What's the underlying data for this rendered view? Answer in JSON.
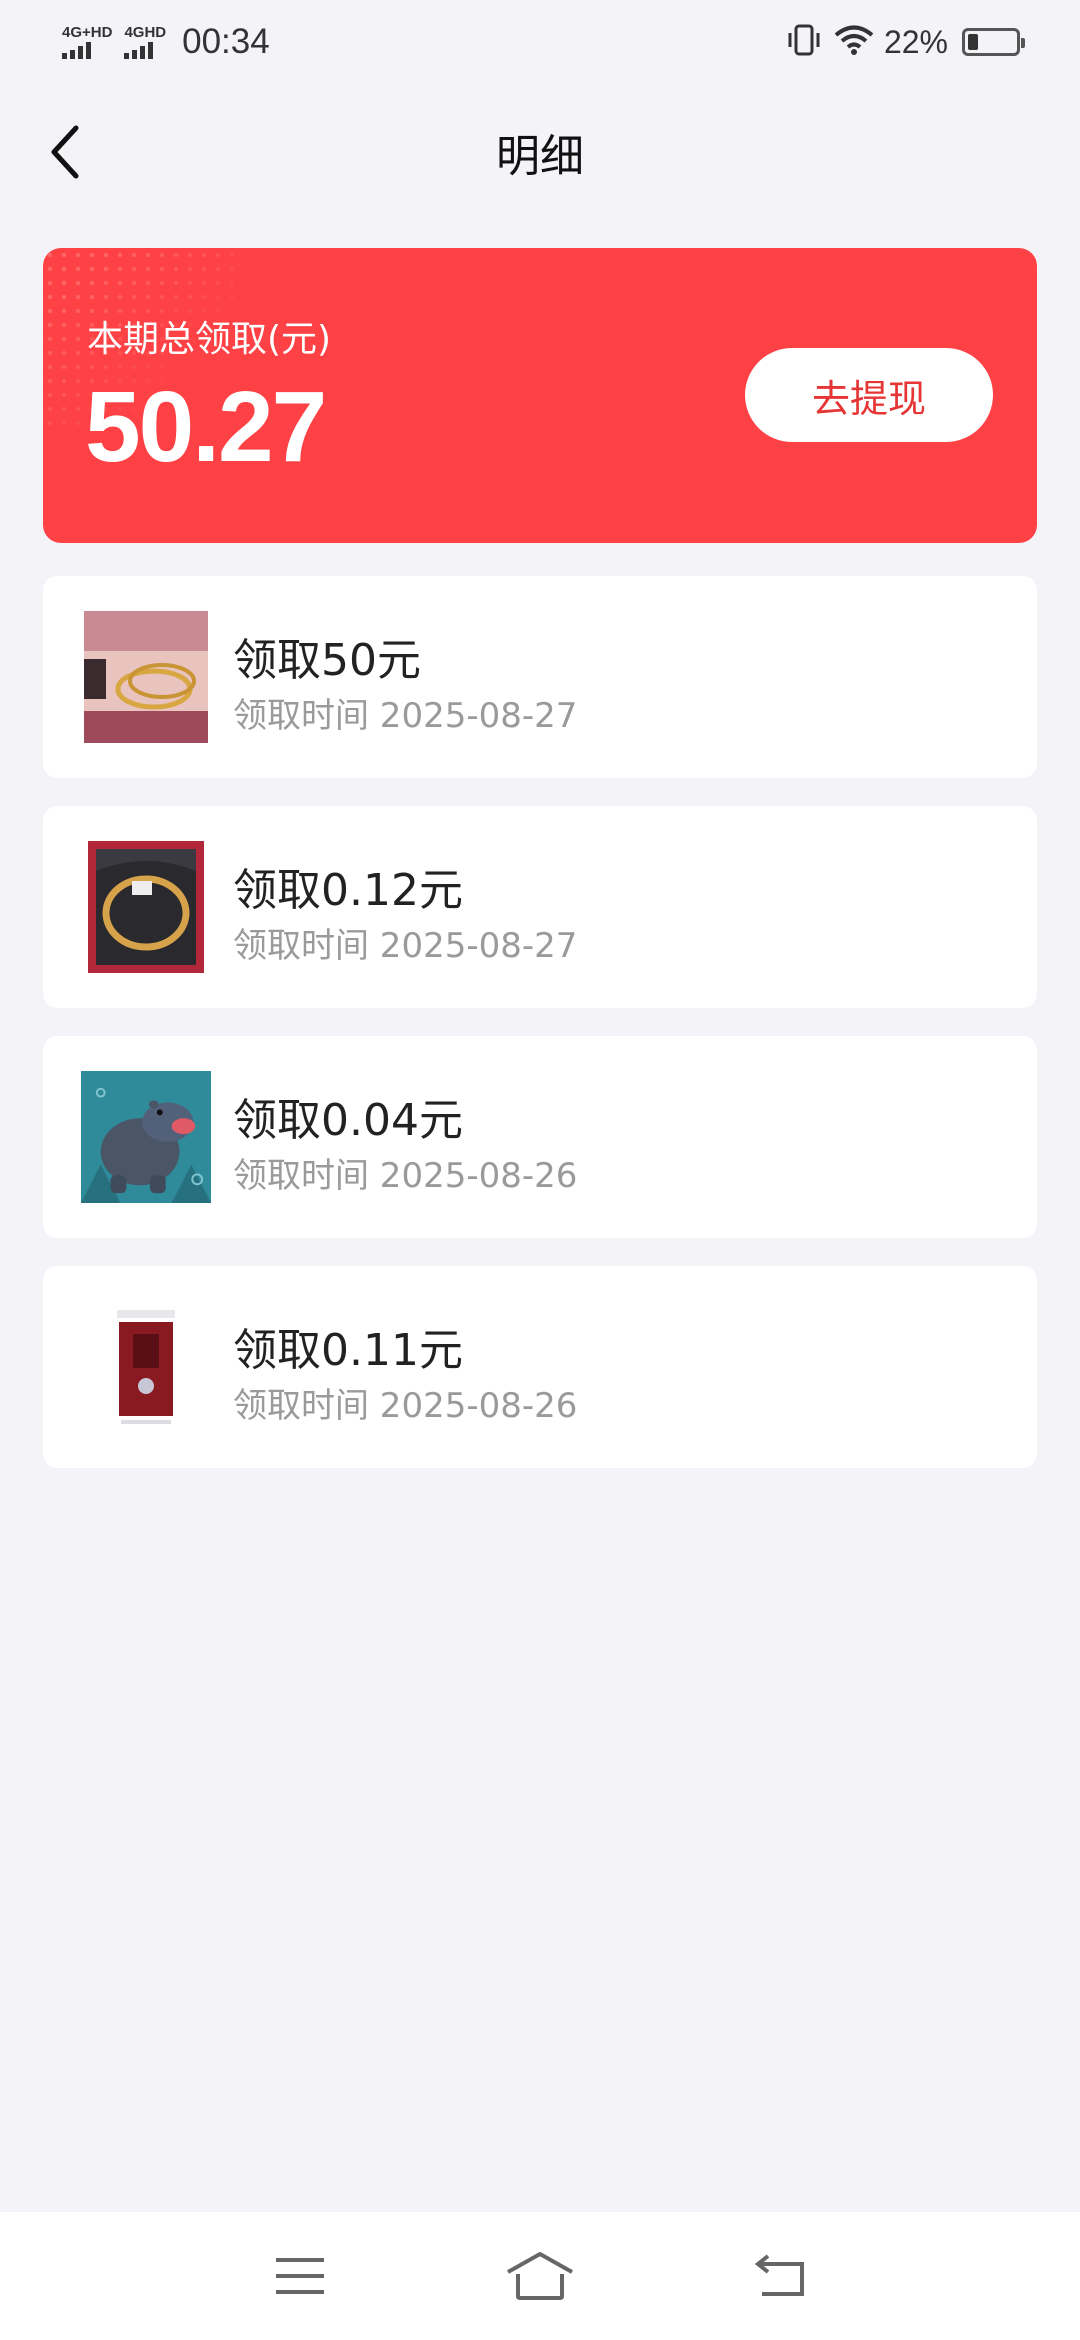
{
  "status_bar": {
    "sim1_label": "4G+HD",
    "sim2_label": "4GHD",
    "time": "00:34",
    "battery_pct": "22%",
    "battery_level": 0.22,
    "icons": [
      "vibrate-icon",
      "wifi-icon",
      "battery-icon"
    ]
  },
  "header": {
    "title": "明细",
    "back_icon": "chevron-left-icon"
  },
  "summary": {
    "label": "本期总领取(元)",
    "amount": "50.27",
    "withdraw_label": "去提现",
    "accent_color": "#fe4144"
  },
  "records": [
    {
      "title": "领取50元",
      "time": "领取时间 2025-08-27",
      "thumb": "gold-bracelet-on-wrist-image"
    },
    {
      "title": "领取0.12元",
      "time": "领取时间 2025-08-27",
      "thumb": "gold-bangle-in-box-image"
    },
    {
      "title": "领取0.04元",
      "time": "领取时间 2025-08-26",
      "thumb": "hippo-figurine-image"
    },
    {
      "title": "领取0.11元",
      "time": "领取时间 2025-08-26",
      "thumb": "phone-screenshot-image"
    }
  ],
  "navbar": {
    "icons": [
      "menu-icon",
      "home-icon",
      "back-icon"
    ]
  }
}
